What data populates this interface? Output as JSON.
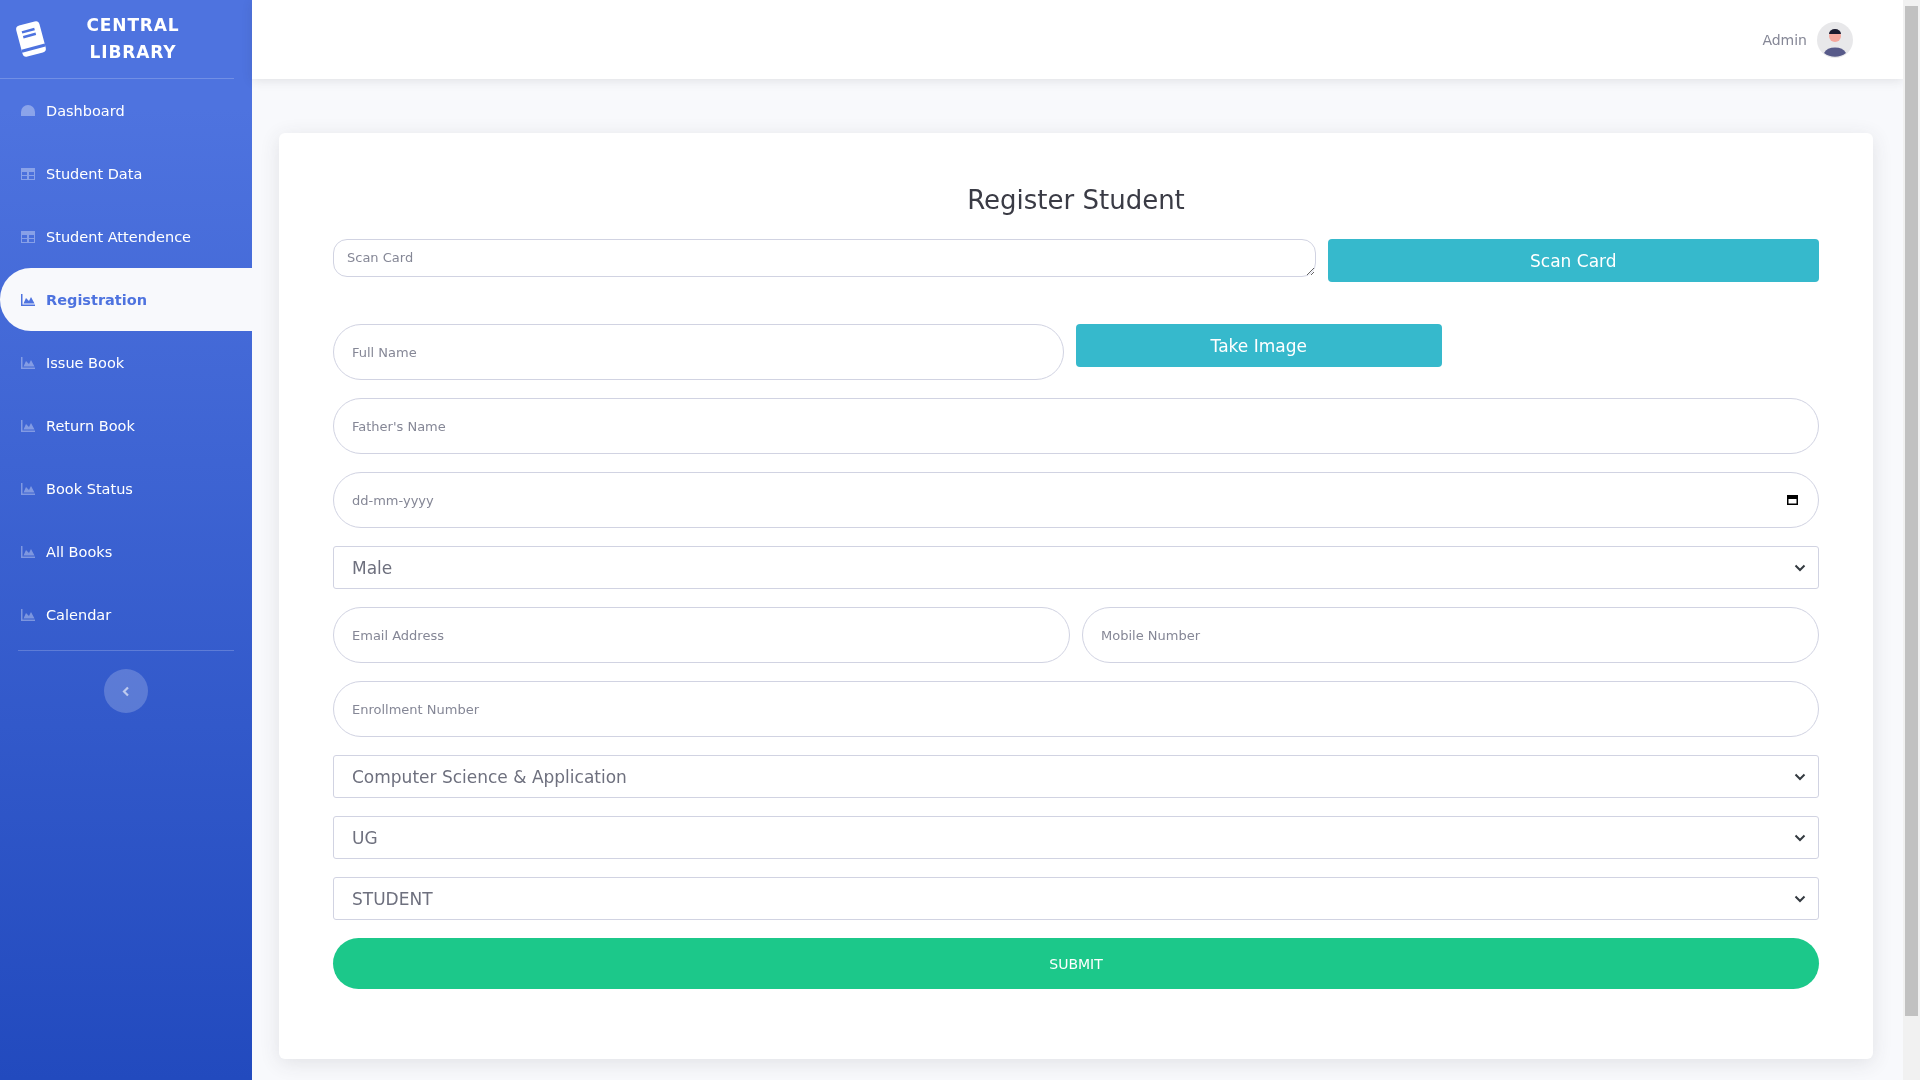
{
  "sidebar": {
    "title": "CENTRAL LIBRARY",
    "items": [
      {
        "label": "Dashboard",
        "selected": false
      },
      {
        "label": "Student Data",
        "selected": false
      },
      {
        "label": "Student Attendence",
        "selected": false
      },
      {
        "label": "Registration",
        "selected": true
      },
      {
        "label": "Issue Book",
        "selected": false
      },
      {
        "label": "Return Book",
        "selected": false
      },
      {
        "label": "Book Status",
        "selected": false
      },
      {
        "label": "All Books",
        "selected": false
      },
      {
        "label": "Calendar",
        "selected": false
      }
    ]
  },
  "topbar": {
    "user": "Admin"
  },
  "form": {
    "title": "Register Student",
    "rows": [
      [
        {
          "kind": "textarea",
          "placeholder": "Scan Card"
        },
        {
          "kind": "button",
          "label": "Scan Card"
        }
      ],
      [
        {
          "kind": "text",
          "placeholder": "Full Name"
        },
        {
          "kind": "button",
          "label": "Take Image"
        }
      ],
      [
        {
          "kind": "text",
          "placeholder": "Father's Name"
        }
      ],
      [
        {
          "kind": "date",
          "placeholder": "dd-mm-yyyy"
        }
      ],
      [
        {
          "kind": "select",
          "value": "Male"
        }
      ],
      [
        {
          "kind": "text",
          "placeholder": "Email Address"
        },
        {
          "kind": "text",
          "placeholder": "Mobile Number"
        }
      ],
      [
        {
          "kind": "text",
          "placeholder": "Enrollment Number"
        }
      ],
      [
        {
          "kind": "select",
          "value": "Computer Science & Application"
        }
      ],
      [
        {
          "kind": "select",
          "value": "UG"
        }
      ],
      [
        {
          "kind": "select",
          "value": "STUDENT"
        }
      ],
      [
        {
          "kind": "submit",
          "label": "SUBMIT"
        }
      ]
    ]
  }
}
